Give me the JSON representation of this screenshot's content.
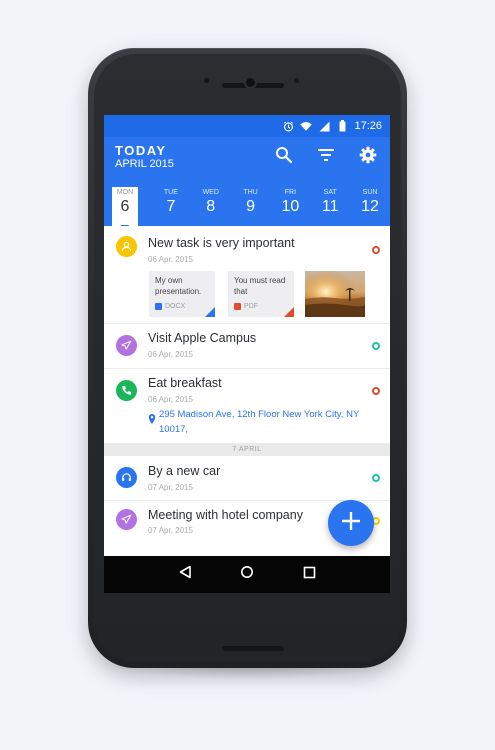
{
  "status_bar": {
    "time": "17:26",
    "icons": [
      "alarm-icon",
      "wifi-icon",
      "signal-icon",
      "battery-icon"
    ]
  },
  "header": {
    "title": "TODAY",
    "subtitle": "APRIL 2015",
    "actions": [
      "search-icon",
      "filter-icon",
      "settings-icon"
    ]
  },
  "week": [
    {
      "name": "MON",
      "date": "6",
      "selected": true
    },
    {
      "name": "TUE",
      "date": "7"
    },
    {
      "name": "WED",
      "date": "8"
    },
    {
      "name": "THU",
      "date": "9"
    },
    {
      "name": "FRI",
      "date": "10"
    },
    {
      "name": "SAT",
      "date": "11"
    },
    {
      "name": "SUN",
      "date": "12"
    }
  ],
  "tasks": [
    {
      "title": "New task is very important",
      "date": "06 Apr, 2015",
      "icon": "person-icon",
      "icon_color": "#f7c600",
      "status_color": "#e24b2e",
      "attachments": [
        {
          "name": "My own presentation.",
          "type": "DOCX",
          "badge_color": "#2a74f0",
          "corner_color": "#2a74f0"
        },
        {
          "name": "You must read that",
          "type": "PDF",
          "badge_color": "#e24b2e",
          "corner_color": "#e24b2e"
        }
      ]
    },
    {
      "title": "Visit Apple Campus",
      "date": "06 Apr, 2015",
      "icon": "airplane-icon",
      "icon_color": "#b272e0",
      "status_color": "#1cc5a8"
    },
    {
      "title": "Eat breakfast",
      "date": "06 Apr, 2015",
      "icon": "phone-icon",
      "icon_color": "#19b65a",
      "status_color": "#e24b2e",
      "address": "295 Madison Ave, 12th Floor New York City, NY 10017,"
    }
  ],
  "separator": "7 APRIL",
  "tasks_2": [
    {
      "title": "By a new car",
      "date": "07 Apr, 2015",
      "icon": "headset-icon",
      "icon_color": "#2a74f0",
      "status_color": "#1cc5a8"
    },
    {
      "title": "Meeting with hotel company",
      "date": "07 Apr, 2015",
      "icon": "airplane-icon",
      "icon_color": "#b272e0",
      "status_color": "#f2d300"
    }
  ],
  "fab": {
    "icon": "plus-icon"
  },
  "nav": [
    "back-icon",
    "home-icon",
    "recents-icon"
  ],
  "colors": {
    "primary": "#2a74f0",
    "status_bar": "#1f6ae6"
  }
}
